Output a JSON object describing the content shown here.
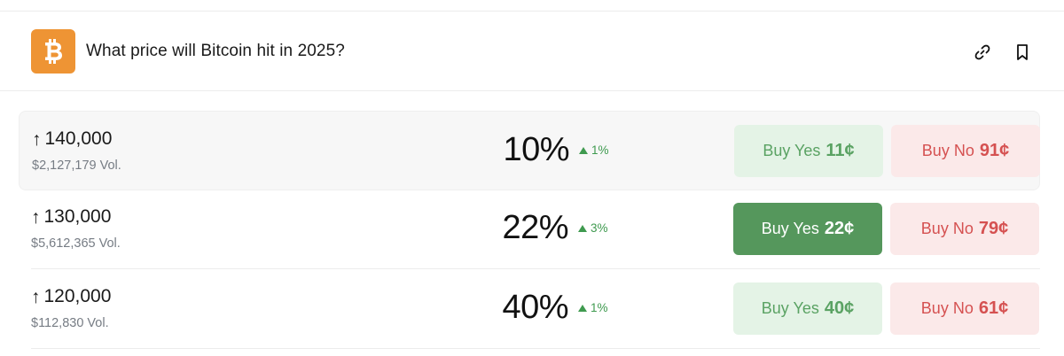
{
  "market": {
    "title": "What price will Bitcoin hit in 2025?",
    "icon": "bitcoin-logo",
    "brand_color": "#ee9434"
  },
  "header_icons": [
    "link-icon",
    "bookmark-icon"
  ],
  "rows": [
    {
      "target": "140,000",
      "volume": "$2,127,179 Vol.",
      "percent": "10%",
      "change": "1%",
      "yes_label": "Buy Yes",
      "yes_price": "11¢",
      "no_label": "Buy No",
      "no_price": "91¢"
    },
    {
      "target": "130,000",
      "volume": "$5,612,365 Vol.",
      "percent": "22%",
      "change": "3%",
      "yes_label": "Buy Yes",
      "yes_price": "22¢",
      "no_label": "Buy No",
      "no_price": "79¢"
    },
    {
      "target": "120,000",
      "volume": "$112,830 Vol.",
      "percent": "40%",
      "change": "1%",
      "yes_label": "Buy Yes",
      "yes_price": "40¢",
      "no_label": "Buy No",
      "no_price": "61¢"
    }
  ],
  "colors": {
    "yes_light": "#e4f3e6",
    "yes_active": "#55975c",
    "no_light": "#fbe9e9",
    "no_text": "#d55151",
    "change_up": "#3f9a4f"
  }
}
